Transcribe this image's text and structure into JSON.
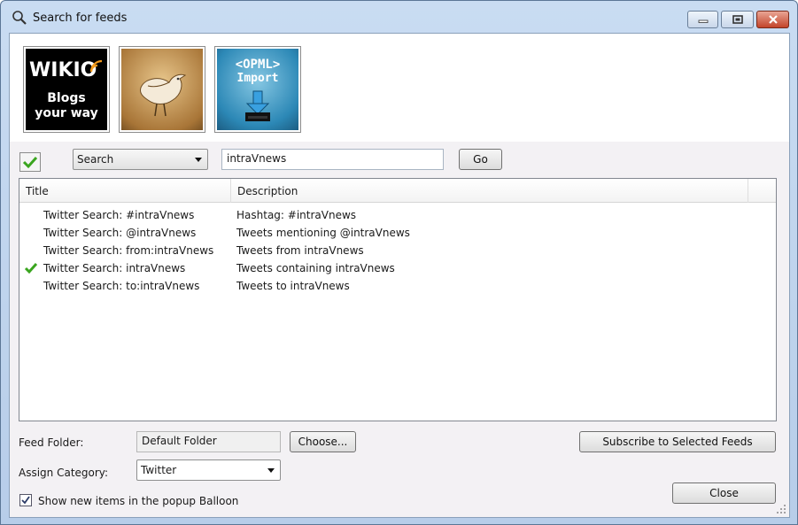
{
  "window": {
    "title": "Search for feeds"
  },
  "logos": [
    {
      "name": "wikio",
      "line1": "WIKIO",
      "line2": "Blogs",
      "line3": "your way"
    },
    {
      "name": "twitter-bird"
    },
    {
      "name": "opml",
      "line1": "<OPML>",
      "line2": "Import"
    }
  ],
  "search": {
    "mode": "Search",
    "query": "intraVnews",
    "go_label": "Go"
  },
  "list": {
    "columns": [
      "Title",
      "Description"
    ],
    "rows": [
      {
        "title": "Twitter Search: #intraVnews",
        "description": "Hashtag: #intraVnews",
        "checked": false
      },
      {
        "title": "Twitter Search: @intraVnews",
        "description": "Tweets mentioning @intraVnews",
        "checked": false
      },
      {
        "title": "Twitter Search: from:intraVnews",
        "description": "Tweets from intraVnews",
        "checked": false
      },
      {
        "title": "Twitter Search: intraVnews",
        "description": "Tweets containing intraVnews",
        "checked": true
      },
      {
        "title": "Twitter Search: to:intraVnews",
        "description": "Tweets to intraVnews",
        "checked": false
      }
    ]
  },
  "feed_folder": {
    "label": "Feed Folder:",
    "value": "Default Folder",
    "choose_label": "Choose..."
  },
  "subscribe_label": "Subscribe to Selected Feeds",
  "category": {
    "label": "Assign Category:",
    "value": "Twitter"
  },
  "balloon": {
    "label": "Show new items in the popup Balloon",
    "checked": true
  },
  "close_label": "Close",
  "colors": {
    "check_green": "#3aa51f",
    "accent": "#b7cde9"
  }
}
